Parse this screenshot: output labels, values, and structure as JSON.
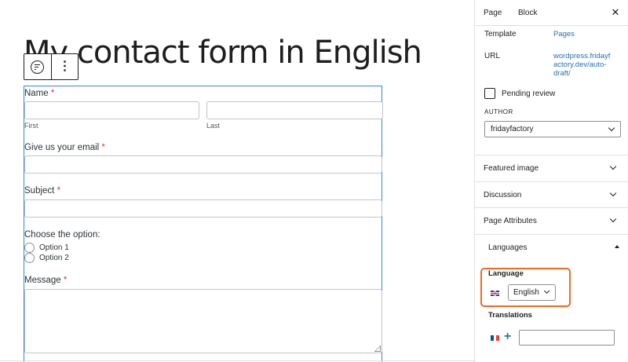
{
  "editor": {
    "page_title": "My contact form in English",
    "toolbar": {
      "block_icon": "forms-icon",
      "options_icon": "kebab-icon",
      "options_glyph": "⋮"
    },
    "form": {
      "name_label": "Name",
      "required_mark": "*",
      "first_sublabel": "First",
      "last_sublabel": "Last",
      "email_label": "Give us your email",
      "subject_label": "Subject",
      "choose_label": "Choose the option:",
      "options": [
        "Option 1",
        "Option 2"
      ],
      "message_label": "Message"
    }
  },
  "sidebar": {
    "tabs": {
      "page": "Page",
      "block": "Block"
    },
    "close_glyph": "✕",
    "template_label": "Template",
    "template_value": "Pages",
    "url_label": "URL",
    "url_lines": [
      "wordpress.fridayf",
      "actory.dev/auto-",
      "draft/"
    ],
    "pending_review": "Pending review",
    "author_label": "AUTHOR",
    "author_value": "fridayfactory",
    "panels": [
      "Featured image",
      "Discussion",
      "Page Attributes"
    ],
    "languages": {
      "title": "Languages",
      "language_label": "Language",
      "language_value": "English",
      "translations_label": "Translations",
      "add_glyph": "+"
    }
  },
  "colors": {
    "accent": "#2271b1",
    "highlight": "#ee6a25",
    "block_outline": "#3584e4",
    "required": "#d63638"
  }
}
